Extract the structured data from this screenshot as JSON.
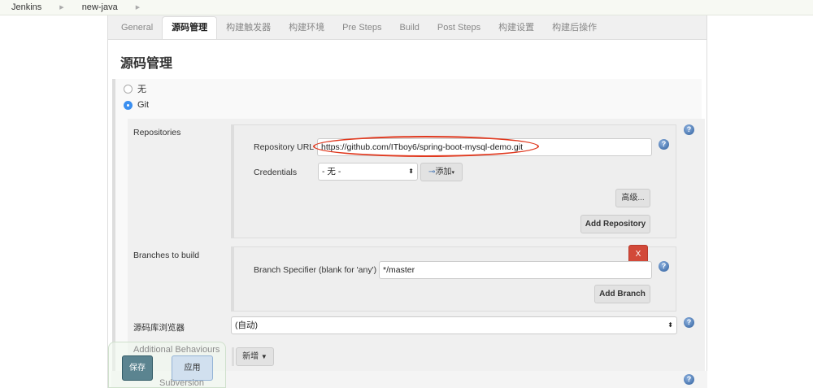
{
  "breadcrumb": {
    "items": [
      "Jenkins",
      "new-java"
    ]
  },
  "tabs": [
    "General",
    "源码管理",
    "构建触发器",
    "构建环境",
    "Pre Steps",
    "Build",
    "Post Steps",
    "构建设置",
    "构建后操作"
  ],
  "section_title": "源码管理",
  "scm_options": {
    "none": "无",
    "git": "Git",
    "subversion": "Subversion"
  },
  "repositories": {
    "label": "Repositories",
    "url_label": "Repository URL",
    "url_value": "https://github.com/ITboy6/spring-boot-mysql-demo.git",
    "credentials_label": "Credentials",
    "credentials_value": "- 无 -",
    "add_label": "添加",
    "advanced_label": "高级...",
    "add_repository_label": "Add Repository"
  },
  "branches": {
    "label": "Branches to build",
    "specifier_label": "Branch Specifier (blank for 'any')",
    "specifier_value": "*/master",
    "delete_label": "X",
    "add_branch_label": "Add Branch"
  },
  "browser": {
    "label": "源码库浏览器",
    "value": "(自动)"
  },
  "behaviours": {
    "label": "Additional Behaviours",
    "add_label": "新增"
  },
  "footer": {
    "save_label": "保存",
    "apply_label": "应用"
  },
  "help_icon": "?",
  "colors": {
    "accent": "#3b8ff0",
    "highlight_oval": "#e0391f",
    "delete": "#d24939",
    "save": "#41707f"
  }
}
